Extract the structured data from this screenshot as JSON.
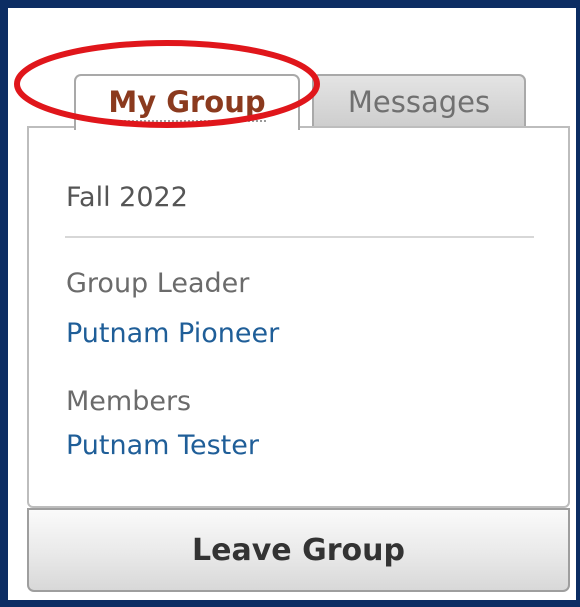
{
  "tabs": {
    "my_group": "My Group",
    "messages": "Messages"
  },
  "group": {
    "term": "Fall 2022",
    "leader_label": "Group Leader",
    "leader_name": "Putnam Pioneer",
    "members_label": "Members",
    "members": [
      "Putnam Tester"
    ]
  },
  "actions": {
    "leave": "Leave Group"
  },
  "colors": {
    "frame": "#0c2d63",
    "active_tab_text": "#8b3a1e",
    "link": "#1f5e98",
    "annotation": "#e0161b"
  }
}
